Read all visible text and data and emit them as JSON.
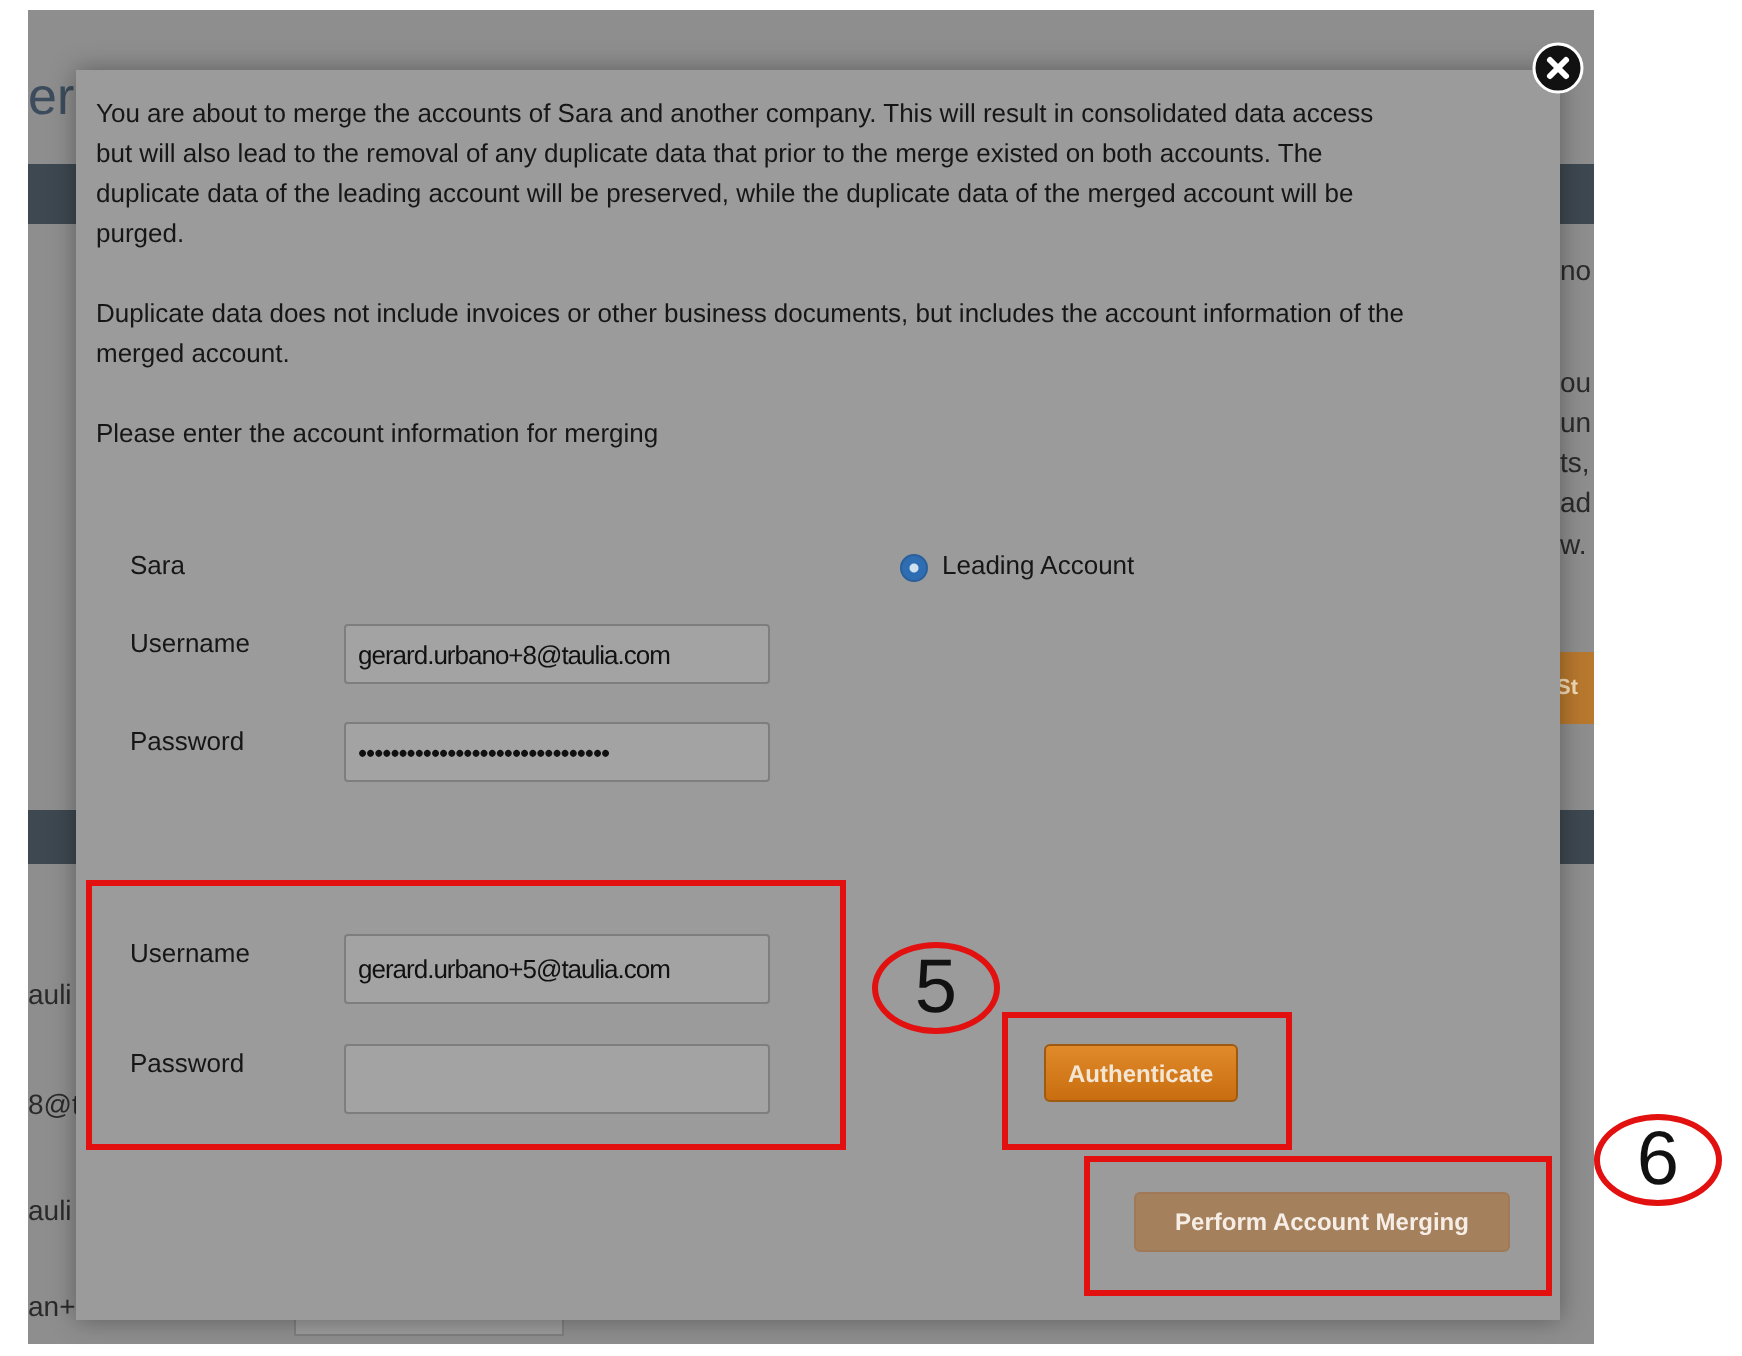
{
  "background_page": {
    "heading_fragment": "er",
    "right_fragments": [
      "no",
      "ou",
      "un",
      "ts,",
      "ad",
      "w."
    ],
    "button_fragment": "St",
    "left_fragments": [
      "auli",
      "8@t",
      "auli",
      "an+"
    ]
  },
  "dialog": {
    "paragraphs": [
      "You are about to merge the accounts of Sara and another company. This will result in consolidated data access but will also lead to the removal of any duplicate data that prior to the merge existed on both accounts. The duplicate data of the leading account will be preserved, while the duplicate data of the merged account will be purged.",
      "Duplicate data does not include invoices or other business documents, but includes the account information of the merged account.",
      "Please enter the account information for merging"
    ],
    "leading": {
      "name": "Sara",
      "radio_label": "Leading Account",
      "selected": true,
      "fields": [
        {
          "label": "Username",
          "value": "gerard.urbano+8@taulia.com"
        },
        {
          "label": "Password",
          "value": "•••••••••••••••••••••••••••••••"
        }
      ]
    },
    "merged": {
      "fields": [
        {
          "label": "Username",
          "value": "gerard.urbano+5@taulia.com"
        },
        {
          "label": "Password"
        }
      ]
    },
    "authenticate_button": {
      "label": "Authenticate",
      "disabled": false
    },
    "merge_button": {
      "label": "Perform Account Merging",
      "disabled": true
    }
  },
  "annotations": [
    {
      "label": "5"
    },
    {
      "label": "6"
    }
  ]
}
